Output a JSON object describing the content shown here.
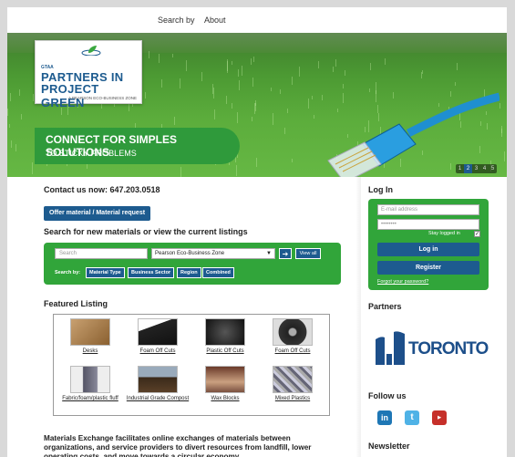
{
  "nav": {
    "items": [
      "Search by",
      "About"
    ]
  },
  "logo": {
    "small": "GTAA",
    "line1": "PARTNERS IN",
    "line2": "PROJECT GREEN",
    "sub": "A PEARSON ECO-BUSINESS ZONE"
  },
  "banner": {
    "title": "CONNECT FOR SIMPLES SOLUTIONS",
    "subtitle": "TO STICKY PROBLEMS"
  },
  "pager": {
    "pages": [
      "1",
      "2",
      "3",
      "4",
      "5"
    ],
    "active": 2
  },
  "contact": "Contact us now: 647.203.0518",
  "offer_button": "Offer material / Material request",
  "search": {
    "title": "Search for new materials or view the current listings",
    "placeholder": "Search",
    "zone": "Pearson Eco-Business Zone",
    "go": "➔",
    "view_all": "View all",
    "by_label": "Search by:",
    "chips": [
      "Material Type",
      "Business Sector",
      "Region",
      "Combined"
    ]
  },
  "featured": {
    "title": "Featured Listing",
    "items": [
      {
        "label": "Desks"
      },
      {
        "label": "Foam Off Cuts"
      },
      {
        "label": "Plastic Off Cuts"
      },
      {
        "label": "Foam Off Cuts"
      },
      {
        "label": "Fabric/foam/plastic fluff"
      },
      {
        "label": "Industrial Grade Compost"
      },
      {
        "label": "Wax Blocks"
      },
      {
        "label": "Mixed Plastics"
      }
    ]
  },
  "about": "Materials Exchange facilitates online exchanges of materials between organizations, and service providers to divert resources from landfill, lower operating costs, and move towards a circular economy.",
  "sidebar": {
    "login_title": "Log In",
    "email_placeholder": "E-mail address",
    "password_placeholder": "••••••••",
    "stay": "Stay logged in",
    "login_btn": "Log in",
    "register_btn": "Register",
    "forgot": "Forgot your password?",
    "partners_title": "Partners",
    "partner_name": "TORONTO",
    "follow_title": "Follow us",
    "newsletter_title": "Newsletter"
  },
  "colors": {
    "green": "#31a53a",
    "blue": "#1d5b8f"
  }
}
